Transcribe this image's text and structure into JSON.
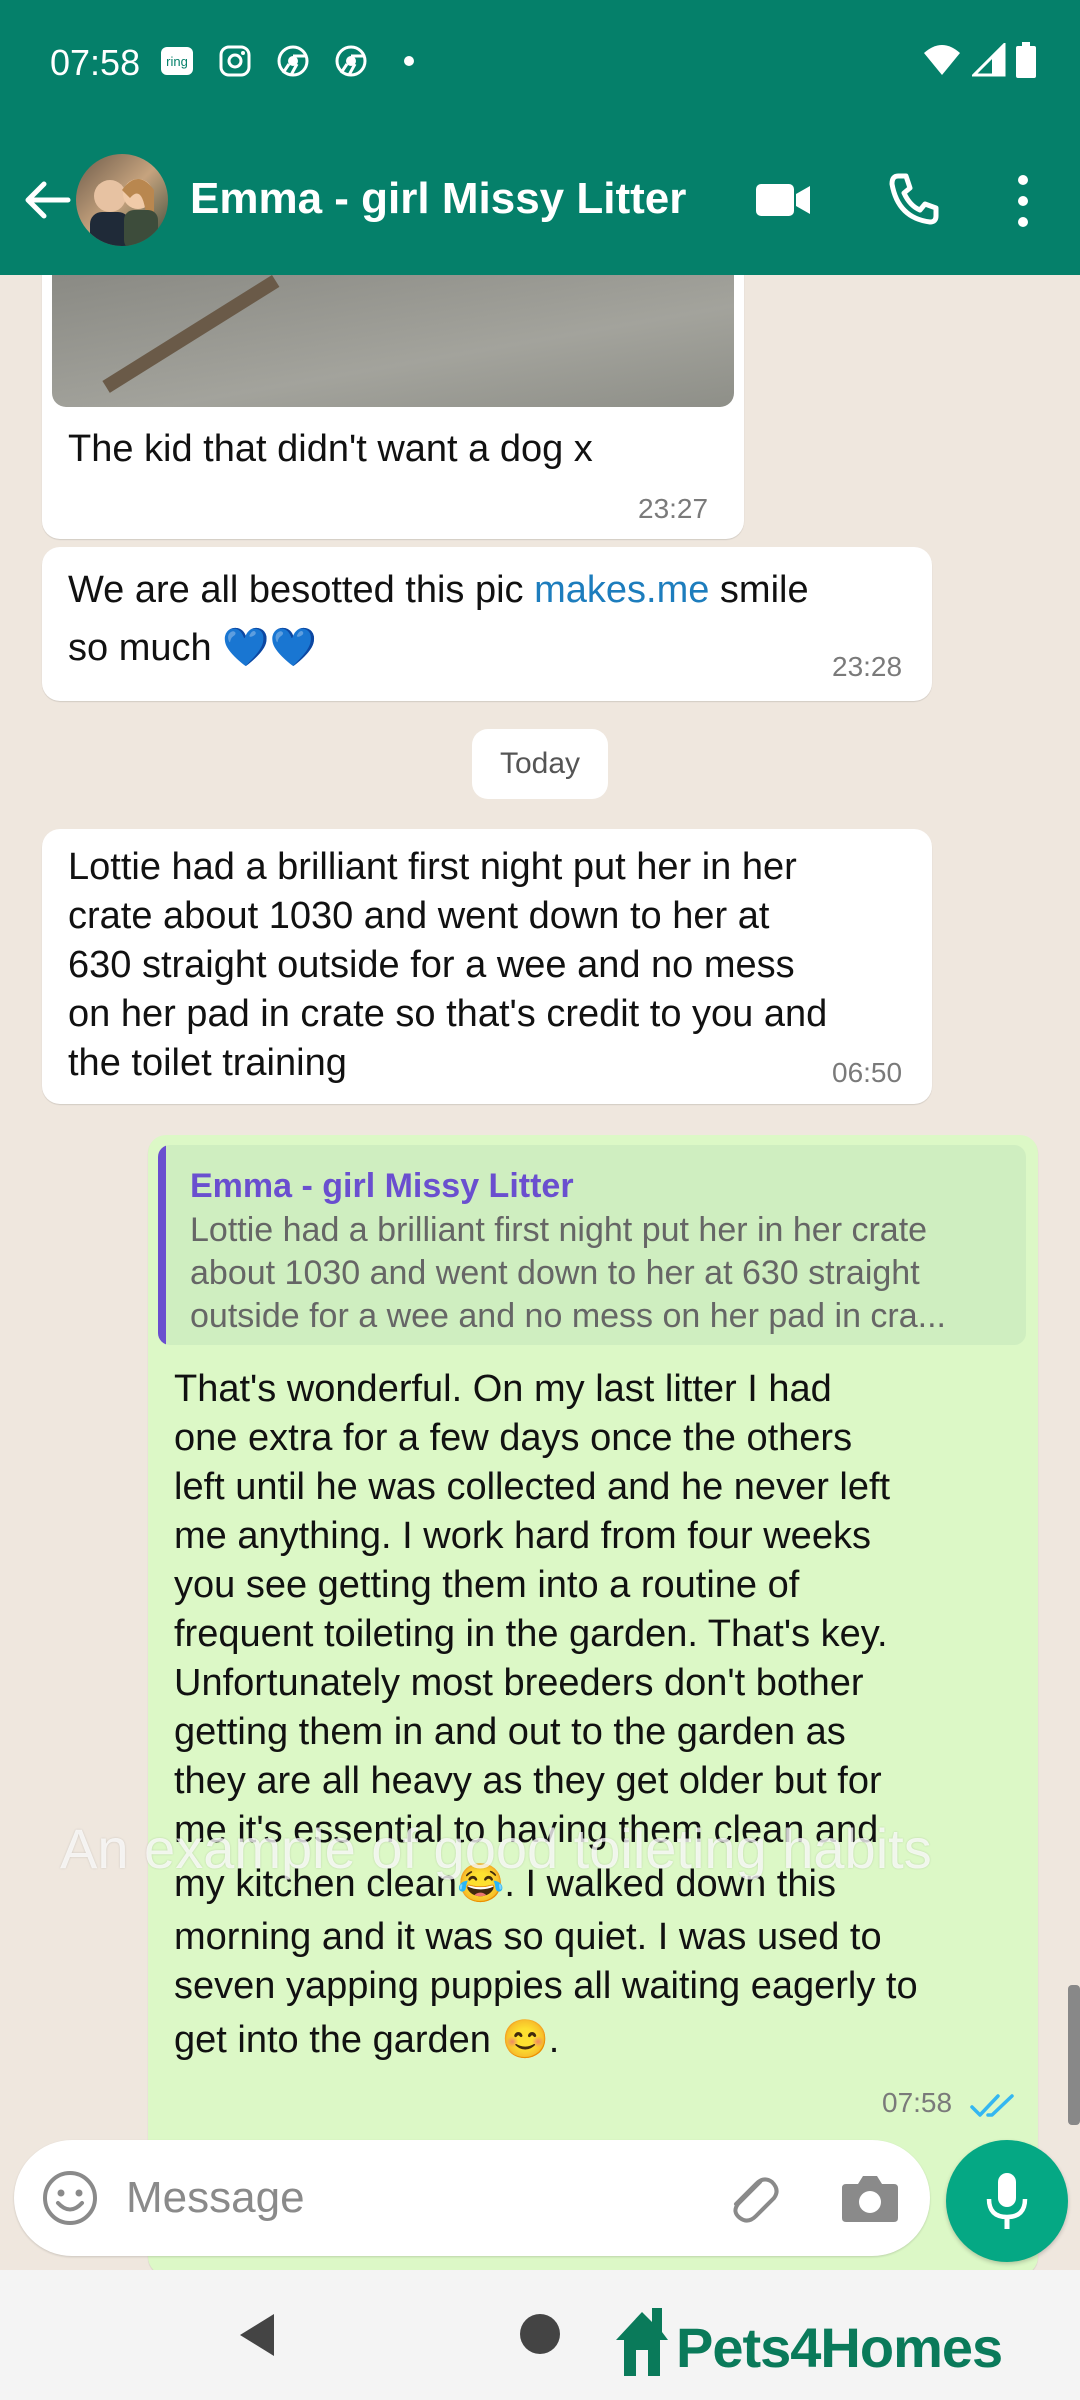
{
  "status_bar": {
    "time": "07:58",
    "icons": [
      "ring-icon",
      "instagram-icon",
      "chrome-icon",
      "chrome-icon",
      "dot-icon"
    ],
    "right_icons": [
      "wifi-icon",
      "signal-icon",
      "battery-icon"
    ]
  },
  "header": {
    "contact_name": "Emma - girl Missy Litter",
    "accent_color": "#05806a"
  },
  "messages": {
    "m1": {
      "text": "The kid that didn't want a dog x",
      "time": "23:27"
    },
    "m2": {
      "text_before": "We are all besotted this pic ",
      "link": "makes.me",
      "text_after": " smile",
      "text_line2": "so much 💙💙",
      "time": "23:28"
    },
    "date_divider": "Today",
    "m3": {
      "lines": [
        "Lottie had a brilliant first night put her in her",
        "crate about 1030 and went down to her at",
        "630 straight outside for a wee and no mess",
        "on her pad in crate so that's credit to you and",
        "the toilet training"
      ],
      "time": "06:50"
    },
    "m4": {
      "quote_name": "Emma - girl Missy Litter",
      "quote_lines": [
        "Lottie had a brilliant first night put her in her crate",
        "about 1030 and went down to her at 630 straight",
        "outside for a wee and no mess on her pad in cra..."
      ],
      "lines": [
        "That's wonderful. On my last litter I had",
        "one extra for a few days once the others",
        "left until he was collected and he never left",
        "me anything. I work hard from four weeks",
        "you see getting them into a routine of",
        "frequent toileting in the garden. That's key.",
        "Unfortunately most breeders don't bother",
        "getting them in and out to the garden as",
        "they are all heavy as they get older but for",
        "me it's essential to having them clean and",
        "my kitchen clean😂. I walked down this",
        "morning and it was so quiet. I was used to",
        "seven yapping puppies all waiting eagerly to",
        "get into the garden 😊."
      ],
      "time": "07:58"
    }
  },
  "caption": "An example of good toileting habits",
  "composer": {
    "placeholder": "Message"
  },
  "brand": "Pets4Homes"
}
